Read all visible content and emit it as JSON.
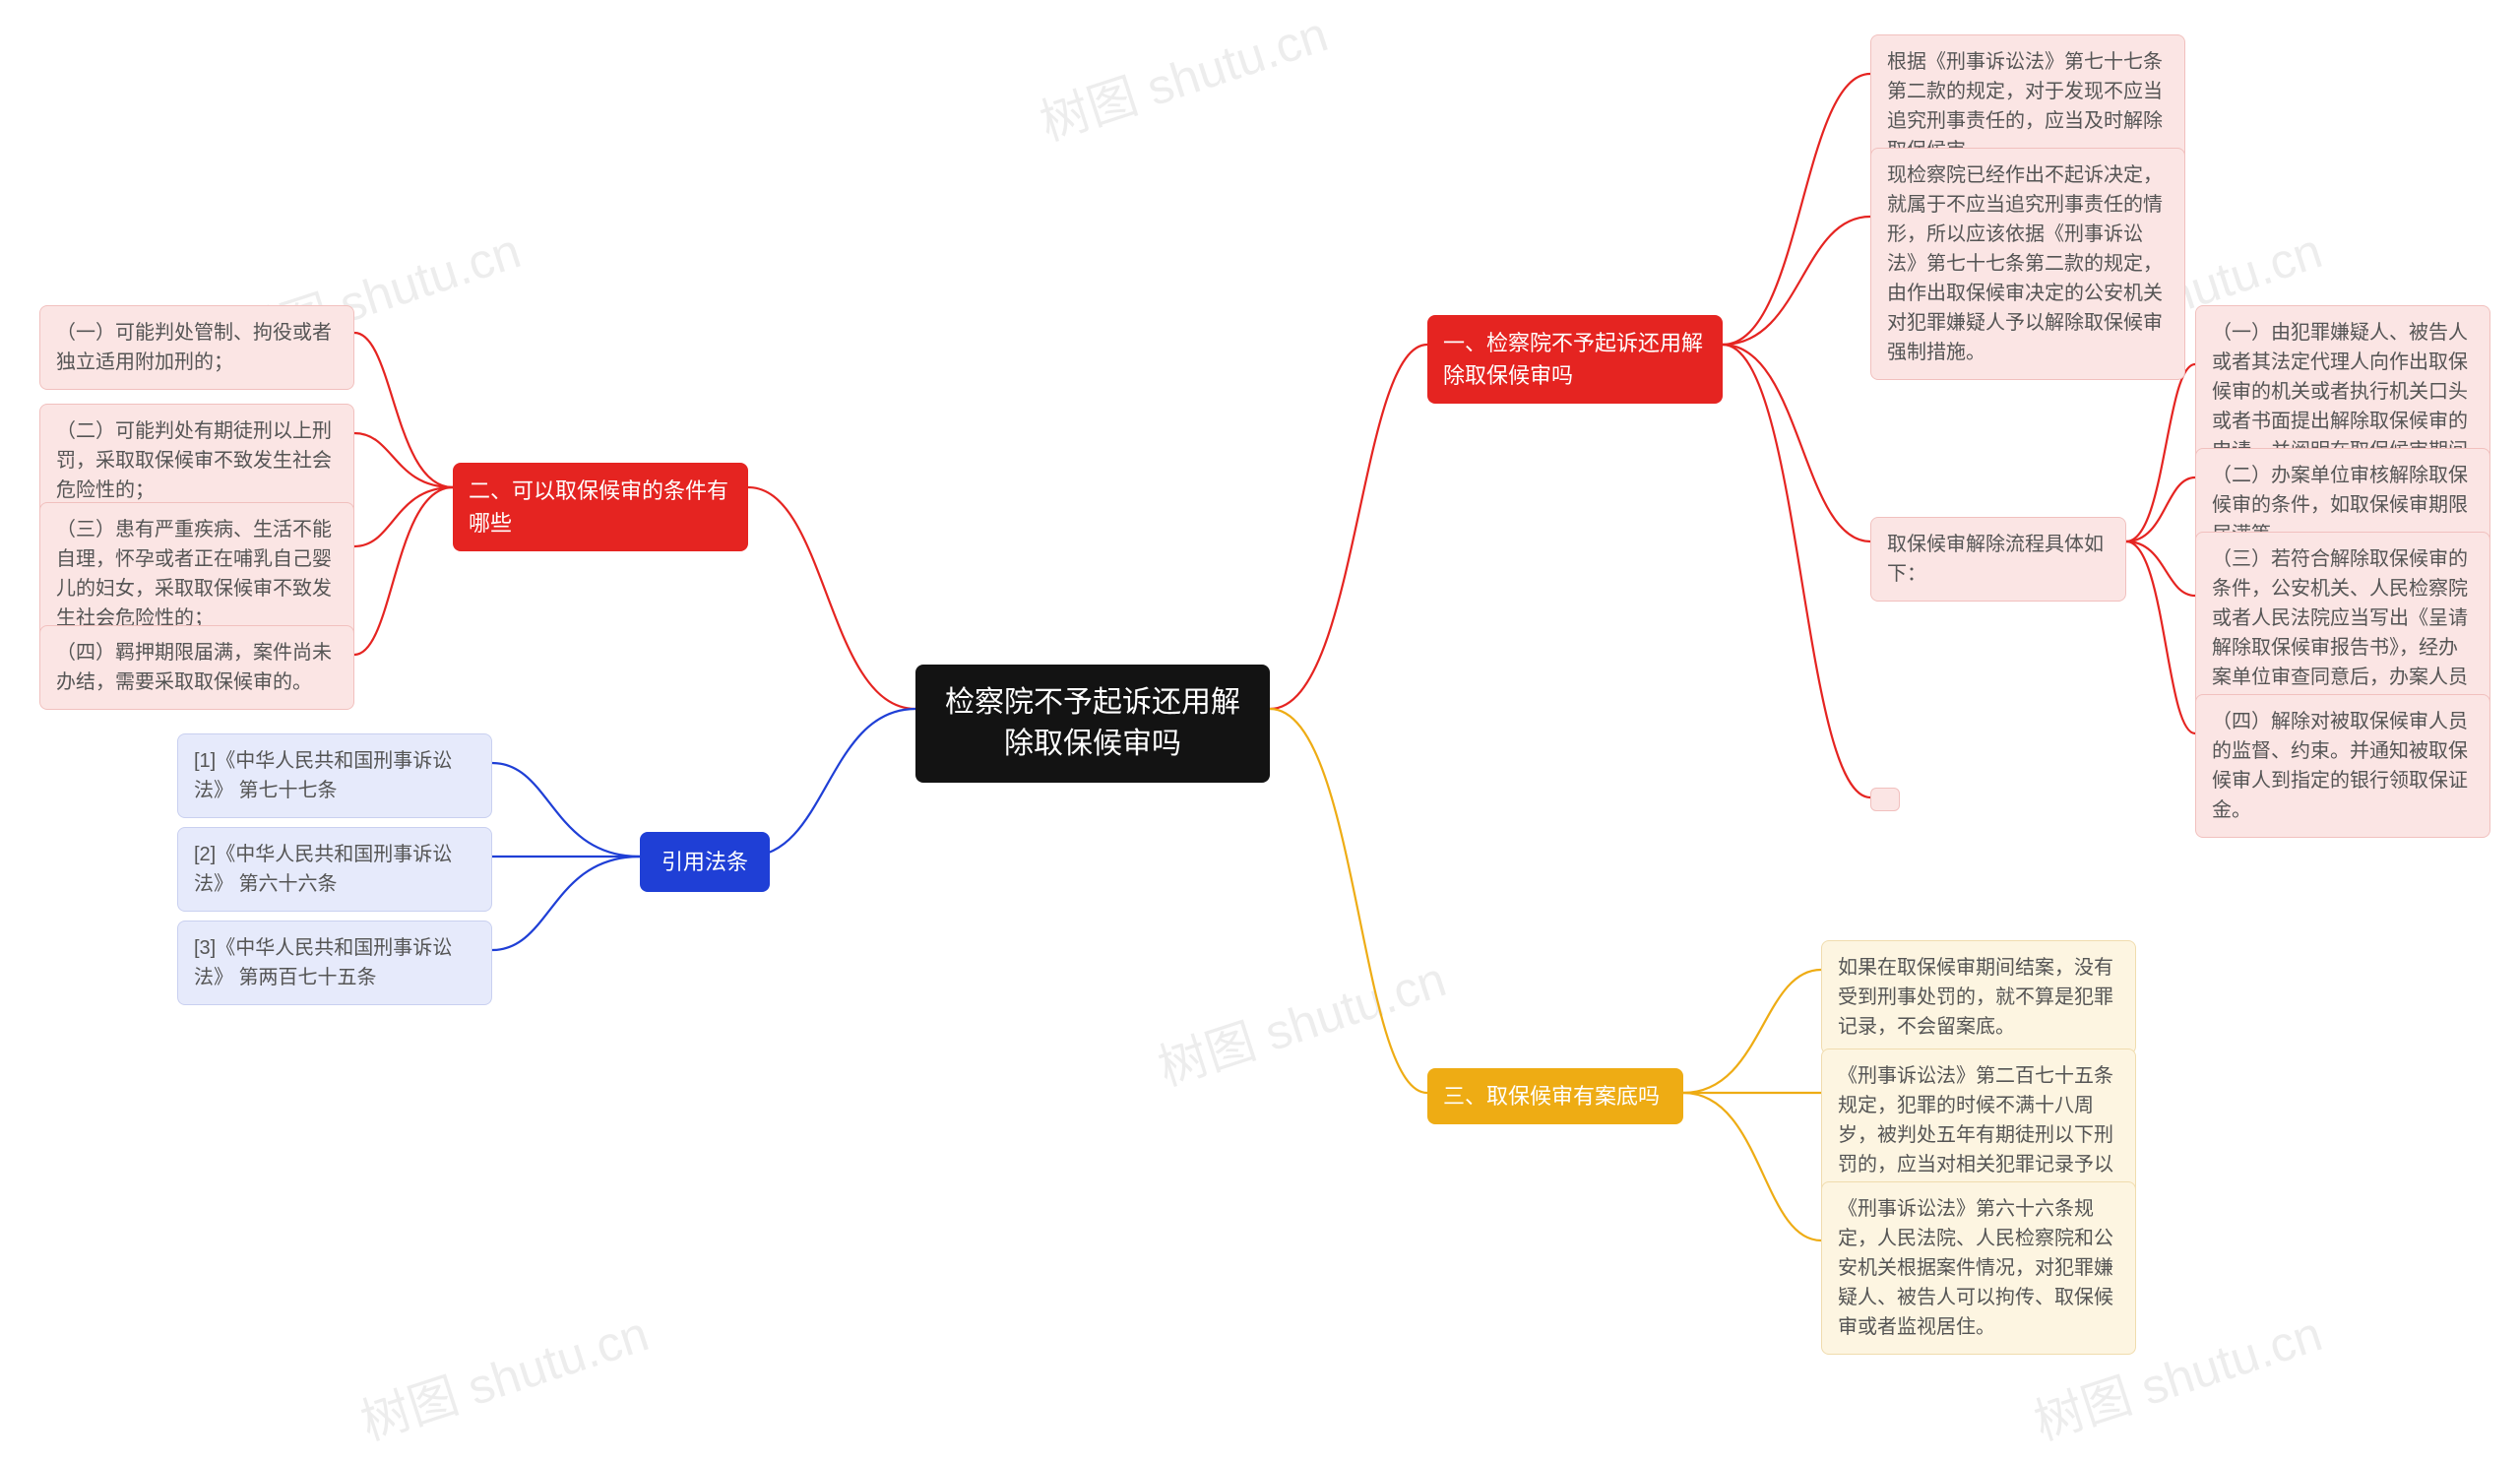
{
  "root": {
    "title": "检察院不予起诉还用解除取保候审吗"
  },
  "branch1": {
    "title": "一、检察院不予起诉还用解除取保候审吗",
    "children": [
      "根据《刑事诉讼法》第七十七条第二款的规定，对于发现不应当追究刑事责任的，应当及时解除取保候审。",
      "现检察院已经作出不起诉决定，就属于不应当追究刑事责任的情形，所以应该依据《刑事诉讼法》第七十七条第二款的规定，由作出取保候审决定的公安机关对犯罪嫌疑人予以解除取保候审强制措施。"
    ],
    "sub": {
      "title": "取保候审解除流程具体如下：",
      "children": [
        "（一）由犯罪嫌疑人、被告人或者其法定代理人向作出取保候审的机关或者执行机关口头或者书面提出解除取保候审的申请，并阐明在取保候审期间没有出现违反义务的情况。",
        "（二）办案单位审核解除取保候审的条件，如取保候审期限届满等。",
        "（三）若符合解除取保候审的条件，公安机关、人民检察院或者人民法院应当写出《呈请解除取保候审报告书》，经办案单位审查同意后，办案人员再制作《解除取保候审决定书、通知书》，办理解除手续。",
        "（四）解除对被取保候审人员的监督、约束。并通知被取保候审人到指定的银行领取保证金。"
      ]
    }
  },
  "branch2": {
    "title": "二、可以取保候审的条件有哪些",
    "children": [
      "（一）可能判处管制、拘役或者独立适用附加刑的；",
      "（二）可能判处有期徒刑以上刑罚，采取取保候审不致发生社会危险性的；",
      "（三）患有严重疾病、生活不能自理，怀孕或者正在哺乳自己婴儿的妇女，采取取保候审不致发生社会危险性的；",
      "（四）羁押期限届满，案件尚未办结，需要采取取保候审的。"
    ]
  },
  "branch3": {
    "title": "三、取保候审有案底吗",
    "children": [
      "如果在取保候审期间结案，没有受到刑事处罚的，就不算是犯罪记录，不会留案底。",
      "《刑事诉讼法》第二百七十五条规定，犯罪的时候不满十八周岁，被判处五年有期徒刑以下刑罚的，应当对相关犯罪记录予以封存。",
      "《刑事诉讼法》第六十六条规定，人民法院、人民检察院和公安机关根据案件情况，对犯罪嫌疑人、被告人可以拘传、取保候审或者监视居住。"
    ]
  },
  "branch4": {
    "title": "引用法条",
    "children": [
      "[1]《中华人民共和国刑事诉讼法》 第七十七条",
      "[2]《中华人民共和国刑事诉讼法》 第六十六条",
      "[3]《中华人民共和国刑事诉讼法》 第两百七十五条"
    ]
  },
  "watermark": "树图 shutu.cn"
}
